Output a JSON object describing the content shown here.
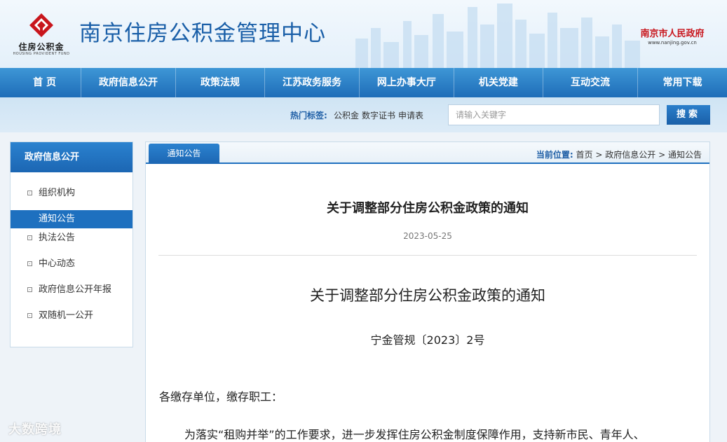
{
  "header": {
    "logo_text": "住房公积金",
    "logo_sub": "HOUSING PROVIDENT FUND",
    "site_title": "南京住房公积金管理中心",
    "gov_name": "南京市人民政府",
    "gov_url": "www.nanjing.gov.cn",
    "brand_color": "#1a5fa8",
    "logo_color": "#c8161d"
  },
  "nav": {
    "items": [
      {
        "label": "首 页"
      },
      {
        "label": "政府信息公开"
      },
      {
        "label": "政策法规"
      },
      {
        "label": "江苏政务服务"
      },
      {
        "label": "网上办事大厅"
      },
      {
        "label": "机关党建"
      },
      {
        "label": "互动交流"
      },
      {
        "label": "常用下载"
      }
    ]
  },
  "search": {
    "hot_label": "热门标签:",
    "tags": [
      "公积金",
      "数字证书",
      "申请表"
    ],
    "placeholder": "请输入关键字",
    "value": "",
    "button_label": "搜索"
  },
  "sidebar": {
    "title": "政府信息公开",
    "items": [
      {
        "label": "组织机构",
        "active": false
      },
      {
        "label": "通知公告",
        "active": true
      },
      {
        "label": "执法公告",
        "active": false
      },
      {
        "label": "中心动态",
        "active": false
      },
      {
        "label": "政府信息公开年报",
        "active": false
      },
      {
        "label": "双随机一公开",
        "active": false
      }
    ]
  },
  "content": {
    "tab_label": "通知公告",
    "breadcrumb": {
      "prefix": "当前位置:",
      "items": [
        "首页",
        "政府信息公开",
        "通知公告"
      ],
      "separator": ">"
    },
    "title": "关于调整部分住房公积金政策的通知",
    "date": "2023-05-25",
    "doc_title": "关于调整部分住房公积金政策的通知",
    "doc_number": "宁金管规〔2023〕2号",
    "salutation": "各缴存单位，缴存职工：",
    "paragraph_1": "为落实“租购并举”的工作要求，进一步发挥住房公积金制度保障作用，支持新市民、青年人、"
  },
  "watermark": "大数跨境"
}
